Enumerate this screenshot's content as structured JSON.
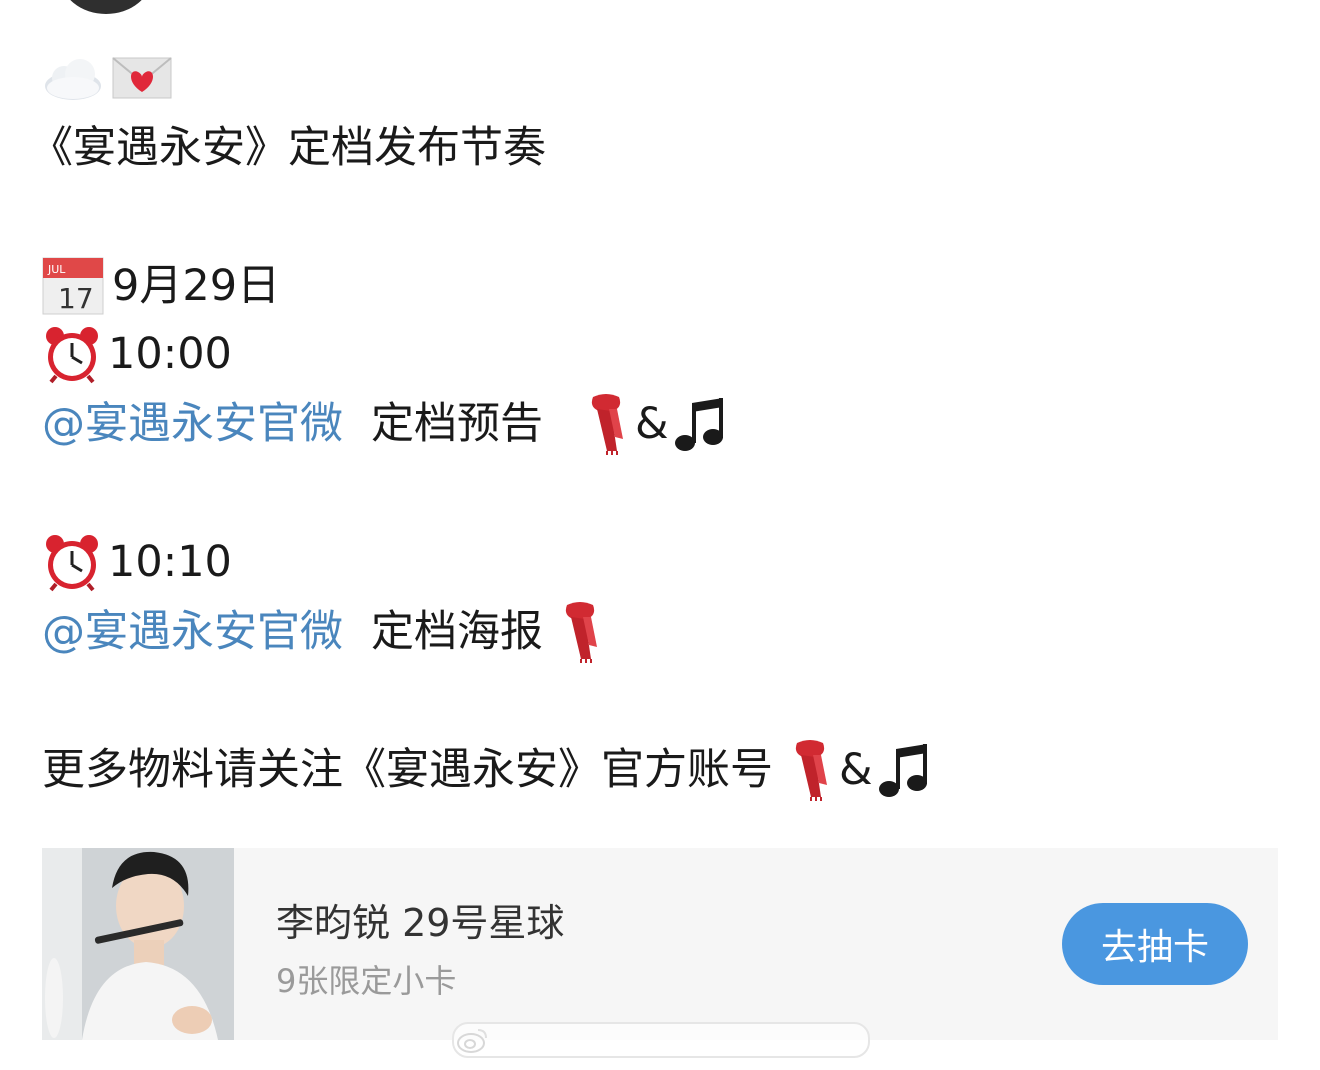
{
  "post": {
    "title_line": "《宴遇永安》定档发布节奏",
    "date": "9月29日",
    "time_1": "10:00",
    "mention_1": "@宴遇永安官微",
    "item_1": "定档预告",
    "amp_1": "&",
    "time_2": "10:10",
    "mention_2": "@宴遇永安官微",
    "item_2": "定档海报",
    "footer_line": "更多物料请关注《宴遇永安》官方账号",
    "amp_2": "&"
  },
  "icons": {
    "line1": [
      "cloud-icon",
      "love-letter-icon"
    ],
    "date": "calendar-icon",
    "time": "alarm-clock-icon",
    "scarf": "scarf-icon",
    "music": "musical-notes-icon"
  },
  "card": {
    "title": "李昀锐 29号星球",
    "subtitle": "9张限定小卡",
    "button_label": "去抽卡"
  },
  "colors": {
    "mention": "#4a86bd",
    "button": "#4a97e0",
    "card_bg": "#f6f6f6",
    "text": "#1a1a1a"
  }
}
